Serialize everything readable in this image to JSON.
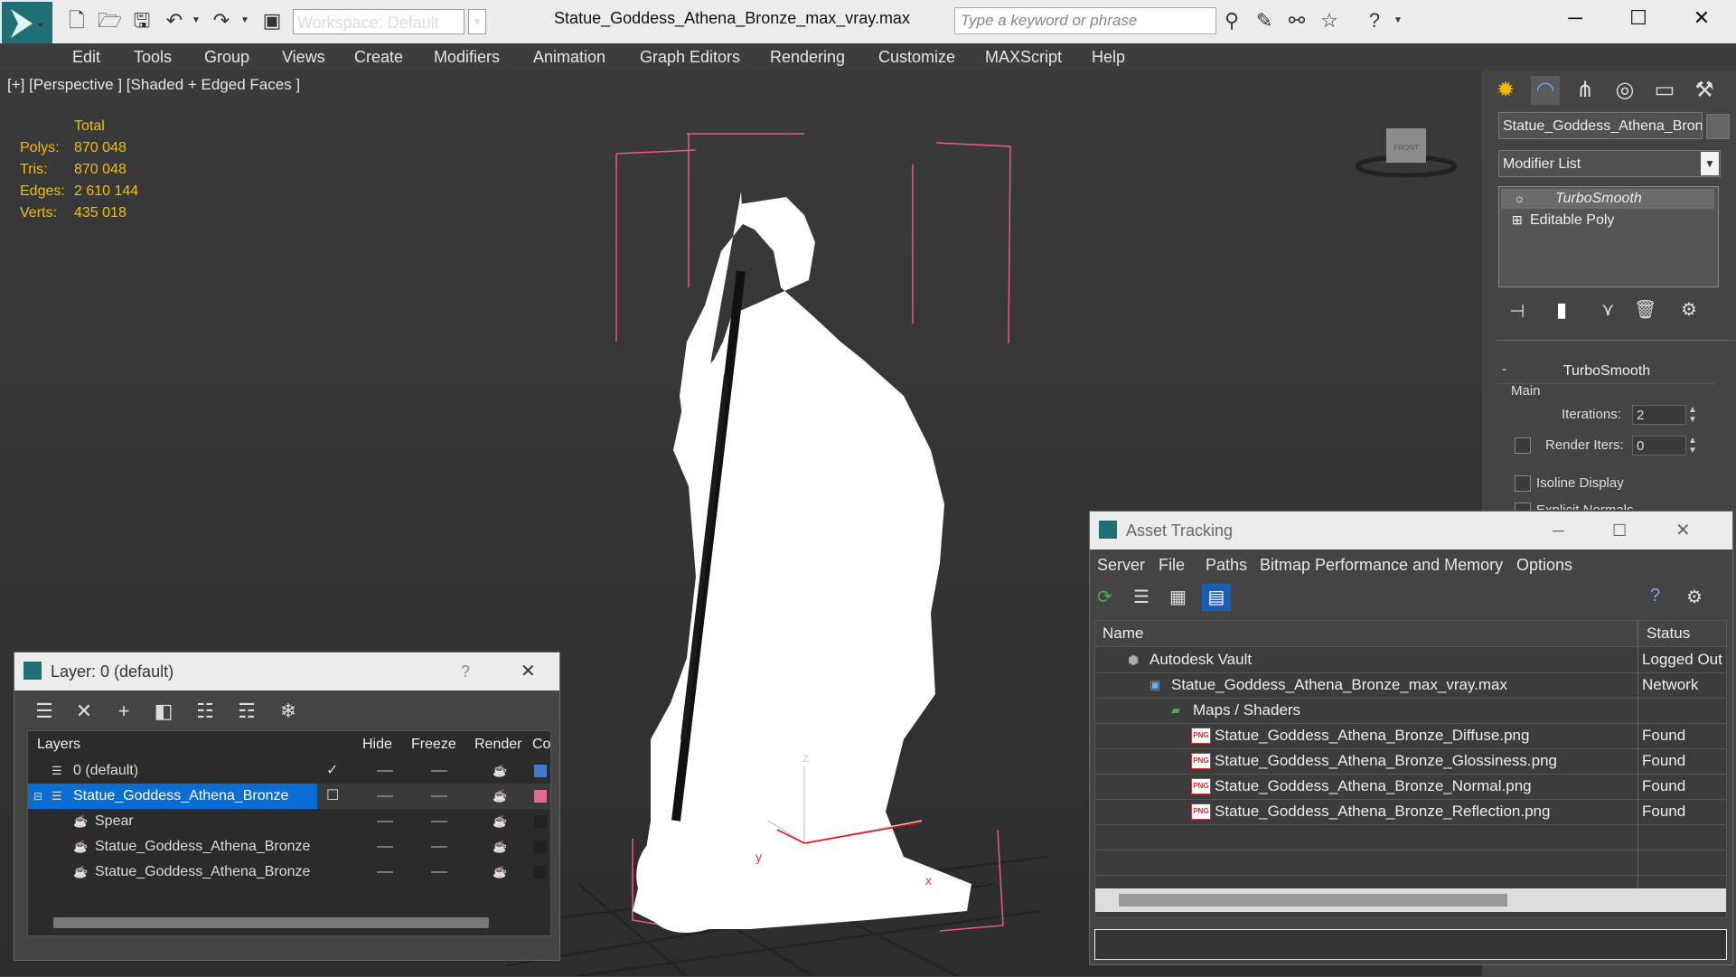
{
  "app": {
    "title": "Statue_Goddess_Athena_Bronze_max_vray.max",
    "workspace": "Workspace: Default",
    "search_placeholder": "Type a keyword or phrase"
  },
  "menu": [
    "Edit",
    "Tools",
    "Group",
    "Views",
    "Create",
    "Modifiers",
    "Animation",
    "Graph Editors",
    "Rendering",
    "Customize",
    "MAXScript",
    "Help"
  ],
  "viewport": {
    "label": "[+] [Perspective ] [Shaded + Edged Faces ]",
    "stats": {
      "header": "Total",
      "rows": [
        {
          "k": "Polys:",
          "v": "870 048"
        },
        {
          "k": "Tris:",
          "v": "870 048"
        },
        {
          "k": "Edges:",
          "v": "2 610 144"
        },
        {
          "k": "Verts:",
          "v": "435 018"
        }
      ]
    },
    "axis": {
      "x": "x",
      "y": "y",
      "z": "z"
    },
    "viewcube_face": "FRONT"
  },
  "command_panel": {
    "object_name": "Statue_Goddess_Athena_Bronze",
    "modifier_list": "Modifier List",
    "stack": [
      "TurboSmooth",
      "Editable Poly"
    ],
    "turbosmooth": {
      "title": "TurboSmooth",
      "group": "Main",
      "iterations_label": "Iterations:",
      "iterations_value": "2",
      "render_iters_label": "Render Iters:",
      "render_iters_value": "0",
      "isoline_label": "Isoline Display",
      "explicit_normals_label": "Explicit Normals"
    }
  },
  "layer_window": {
    "title": "Layer: 0 (default)",
    "help": "?",
    "columns": [
      "Layers",
      "Hide",
      "Freeze",
      "Render",
      "Color"
    ],
    "rows": [
      {
        "name": "0 (default)",
        "indent": 0,
        "selected": false,
        "color": "#3c78d8",
        "checked": true
      },
      {
        "name": "Statue_Goddess_Athena_Bronze",
        "indent": 0,
        "selected": true,
        "color": "#e06b8c",
        "checked": false
      },
      {
        "name": "Spear",
        "indent": 1,
        "selected": false,
        "color": "#222222",
        "checked": false
      },
      {
        "name": "Statue_Goddess_Athena_Bronze",
        "indent": 1,
        "selected": false,
        "color": "#222222",
        "checked": false
      },
      {
        "name": "Statue_Goddess_Athena_Bronze",
        "indent": 1,
        "selected": false,
        "color": "#222222",
        "checked": false
      }
    ]
  },
  "asset_window": {
    "title": "Asset Tracking",
    "menu": [
      "Server",
      "File",
      "Paths",
      "Bitmap Performance and Memory",
      "Options"
    ],
    "columns": [
      "Name",
      "Status"
    ],
    "rows": [
      {
        "name": "Autodesk Vault",
        "status": "Logged Out",
        "indent": 0,
        "icon": "vault-icon"
      },
      {
        "name": "Statue_Goddess_Athena_Bronze_max_vray.max",
        "status": "Network",
        "indent": 1,
        "icon": "max-file-icon"
      },
      {
        "name": "Maps / Shaders",
        "status": "",
        "indent": 2,
        "icon": "maps-icon"
      },
      {
        "name": "Statue_Goddess_Athena_Bronze_Diffuse.png",
        "status": "Found",
        "indent": 3,
        "icon": "png-icon"
      },
      {
        "name": "Statue_Goddess_Athena_Bronze_Glossiness.png",
        "status": "Found",
        "indent": 3,
        "icon": "png-icon"
      },
      {
        "name": "Statue_Goddess_Athena_Bronze_Normal.png",
        "status": "Found",
        "indent": 3,
        "icon": "png-icon"
      },
      {
        "name": "Statue_Goddess_Athena_Bronze_Reflection.png",
        "status": "Found",
        "indent": 3,
        "icon": "png-icon"
      }
    ]
  },
  "colors": {
    "accent": "#0a6dd3",
    "selection_box": "#e85a8a",
    "stats": "#f0c000"
  }
}
